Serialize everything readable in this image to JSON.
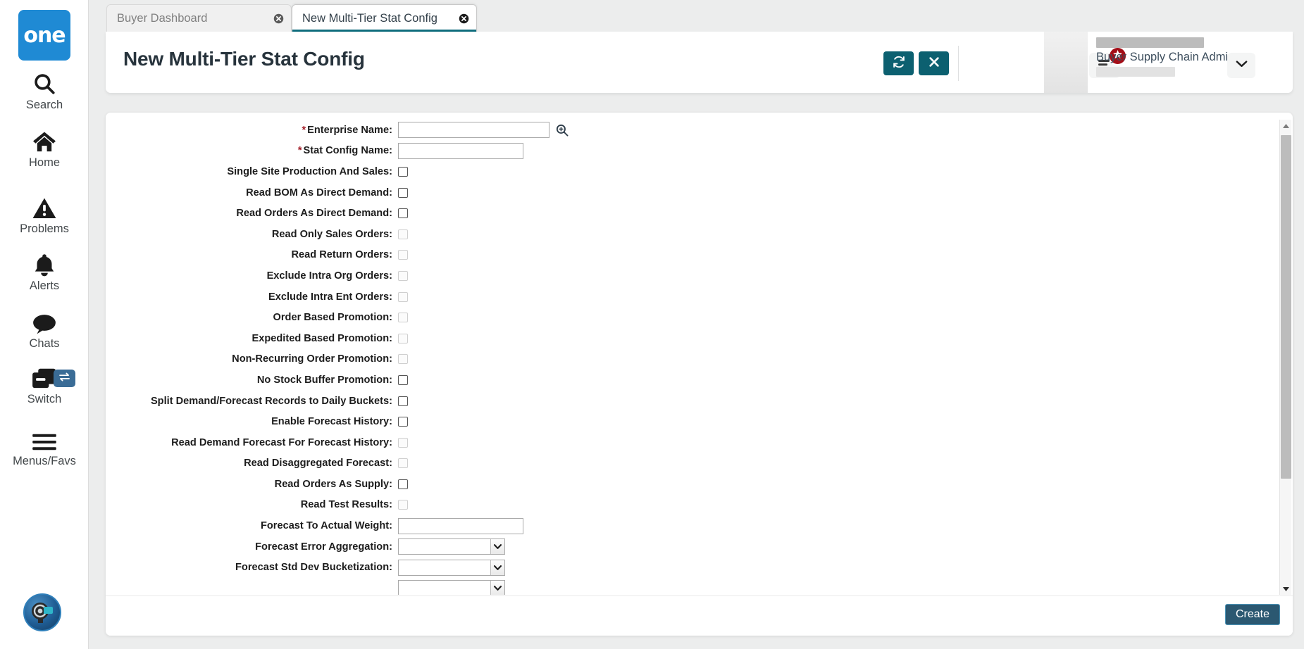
{
  "rail": {
    "logo_text": "one",
    "items": [
      {
        "label": "Search",
        "icon": "search-icon"
      },
      {
        "label": "Home",
        "icon": "home-icon"
      },
      {
        "label": "Problems",
        "icon": "warning-triangle-icon"
      },
      {
        "label": "Alerts",
        "icon": "bell-icon"
      },
      {
        "label": "Chats",
        "icon": "chat-bubble-icon"
      },
      {
        "label": "Switch",
        "icon": "windows-stack-icon"
      },
      {
        "label": "Menus/Favs",
        "icon": "hamburger-icon"
      }
    ],
    "switch_badge_icon": "swap-arrows-icon",
    "avatar_icon": "ai-assistant-avatar-icon"
  },
  "tabs": [
    {
      "label": "Buyer Dashboard",
      "active": false,
      "close_icon": "close-circle-icon"
    },
    {
      "label": "New Multi-Tier Stat Config",
      "active": true,
      "close_icon": "close-circle-icon"
    }
  ],
  "header": {
    "title": "New Multi-Tier Stat Config",
    "refresh_icon": "refresh-icon",
    "close_icon": "close-x-icon",
    "menu_icon": "list-menu-icon",
    "menu_badge_icon": "star-icon",
    "user_name_redacted": true,
    "user_role": "Buyer Supply Chain Admin",
    "user_caret_icon": "chevron-down-icon"
  },
  "form": {
    "rows": [
      {
        "label": "Enterprise Name",
        "required": true,
        "type": "text",
        "value": "",
        "width": "wide",
        "picker": true,
        "picker_icon": "search-plus-icon"
      },
      {
        "label": "Stat Config Name",
        "required": true,
        "type": "text",
        "value": "",
        "width": "mid",
        "picker": false
      },
      {
        "label": "Single Site Production And Sales",
        "required": false,
        "type": "checkbox",
        "checked": false,
        "disabled": false
      },
      {
        "label": "Read BOM As Direct Demand",
        "required": false,
        "type": "checkbox",
        "checked": false,
        "disabled": false
      },
      {
        "label": "Read Orders As Direct Demand",
        "required": false,
        "type": "checkbox",
        "checked": false,
        "disabled": false
      },
      {
        "label": "Read Only Sales Orders",
        "required": false,
        "type": "checkbox",
        "checked": false,
        "disabled": true
      },
      {
        "label": "Read Return Orders",
        "required": false,
        "type": "checkbox",
        "checked": false,
        "disabled": true
      },
      {
        "label": "Exclude Intra Org Orders",
        "required": false,
        "type": "checkbox",
        "checked": false,
        "disabled": true
      },
      {
        "label": "Exclude Intra Ent Orders",
        "required": false,
        "type": "checkbox",
        "checked": false,
        "disabled": true
      },
      {
        "label": "Order Based Promotion",
        "required": false,
        "type": "checkbox",
        "checked": false,
        "disabled": true
      },
      {
        "label": "Expedited Based Promotion",
        "required": false,
        "type": "checkbox",
        "checked": false,
        "disabled": true
      },
      {
        "label": "Non-Recurring Order Promotion",
        "required": false,
        "type": "checkbox",
        "checked": false,
        "disabled": true
      },
      {
        "label": "No Stock Buffer Promotion",
        "required": false,
        "type": "checkbox",
        "checked": false,
        "disabled": false
      },
      {
        "label": "Split Demand/Forecast Records to Daily Buckets",
        "required": false,
        "type": "checkbox",
        "checked": false,
        "disabled": false
      },
      {
        "label": "Enable Forecast History",
        "required": false,
        "type": "checkbox",
        "checked": false,
        "disabled": false
      },
      {
        "label": "Read Demand Forecast For Forecast History",
        "required": false,
        "type": "checkbox",
        "checked": false,
        "disabled": true
      },
      {
        "label": "Read Disaggregated Forecast",
        "required": false,
        "type": "checkbox",
        "checked": false,
        "disabled": true
      },
      {
        "label": "Read Orders As Supply",
        "required": false,
        "type": "checkbox",
        "checked": false,
        "disabled": false
      },
      {
        "label": "Read Test Results",
        "required": false,
        "type": "checkbox",
        "checked": false,
        "disabled": true
      },
      {
        "label": "Forecast To Actual Weight",
        "required": false,
        "type": "text",
        "value": "",
        "width": "mid",
        "picker": false
      },
      {
        "label": "Forecast Error Aggregation",
        "required": false,
        "type": "select",
        "value": "",
        "arrow_icon": "chevron-down-icon"
      },
      {
        "label": "Forecast Std Dev Bucketization",
        "required": false,
        "type": "select",
        "value": "",
        "arrow_icon": "chevron-down-icon"
      },
      {
        "label": "",
        "required": false,
        "type": "select",
        "value": "",
        "arrow_icon": "chevron-down-icon"
      }
    ]
  },
  "scrollbar": {
    "up_arrow_icon": "triangle-up-icon",
    "down_arrow_icon": "triangle-down-icon"
  },
  "footer": {
    "create_label": "Create"
  },
  "colors": {
    "brand_blue": "#1f8ad4",
    "teal_accent": "#0c6070",
    "badge_red": "#a30d17",
    "create_btn": "#2b5871",
    "required_star": "#a4202a"
  }
}
